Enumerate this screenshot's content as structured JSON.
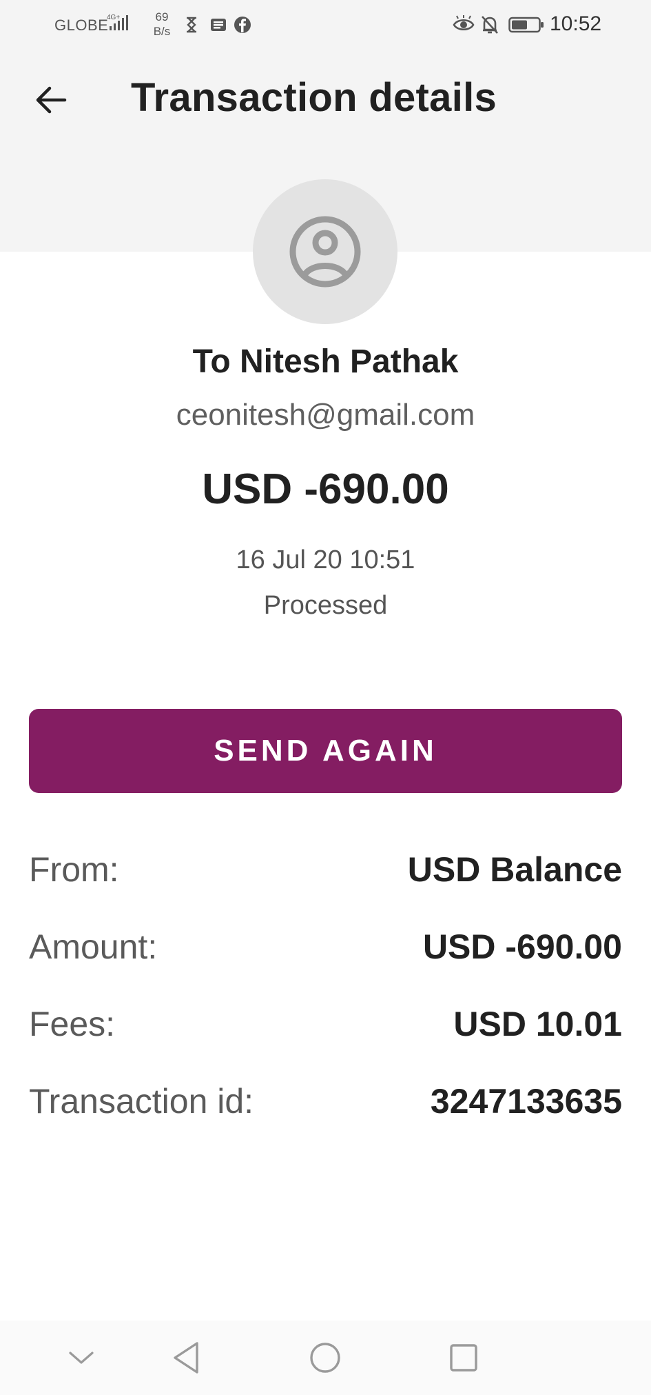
{
  "status_bar": {
    "carrier": "GLOBE",
    "network": "4G+",
    "speed_value": "69",
    "speed_unit": "B/s",
    "time": "10:52",
    "icons": [
      "signal-icon",
      "hourglass-icon",
      "news-icon",
      "facebook-icon",
      "eye-icon",
      "bell-off-icon",
      "battery-icon"
    ]
  },
  "toolbar": {
    "title": "Transaction details",
    "back_icon": "arrow-left-icon"
  },
  "recipient": {
    "avatar_icon": "user-circle-icon",
    "name": "To Nitesh Pathak",
    "email": "ceonitesh@gmail.com"
  },
  "transaction": {
    "amount": "USD -690.00",
    "date": "16 Jul 20 10:51",
    "status": "Processed"
  },
  "actions": {
    "send_again": "SEND AGAIN"
  },
  "details": [
    {
      "label": "From:",
      "value": "USD Balance"
    },
    {
      "label": "Amount:",
      "value": "USD -690.00"
    },
    {
      "label": "Fees:",
      "value": "USD 10.01"
    },
    {
      "label": "Transaction id:",
      "value": "3247133635"
    }
  ],
  "nav_bar": {
    "icons": [
      "chevron-down-icon",
      "nav-back-icon",
      "nav-home-icon",
      "nav-recent-icon"
    ]
  },
  "colors": {
    "accent": "#841d62",
    "header_background": "#f4f4f4",
    "avatar_background": "#e3e3e3"
  }
}
